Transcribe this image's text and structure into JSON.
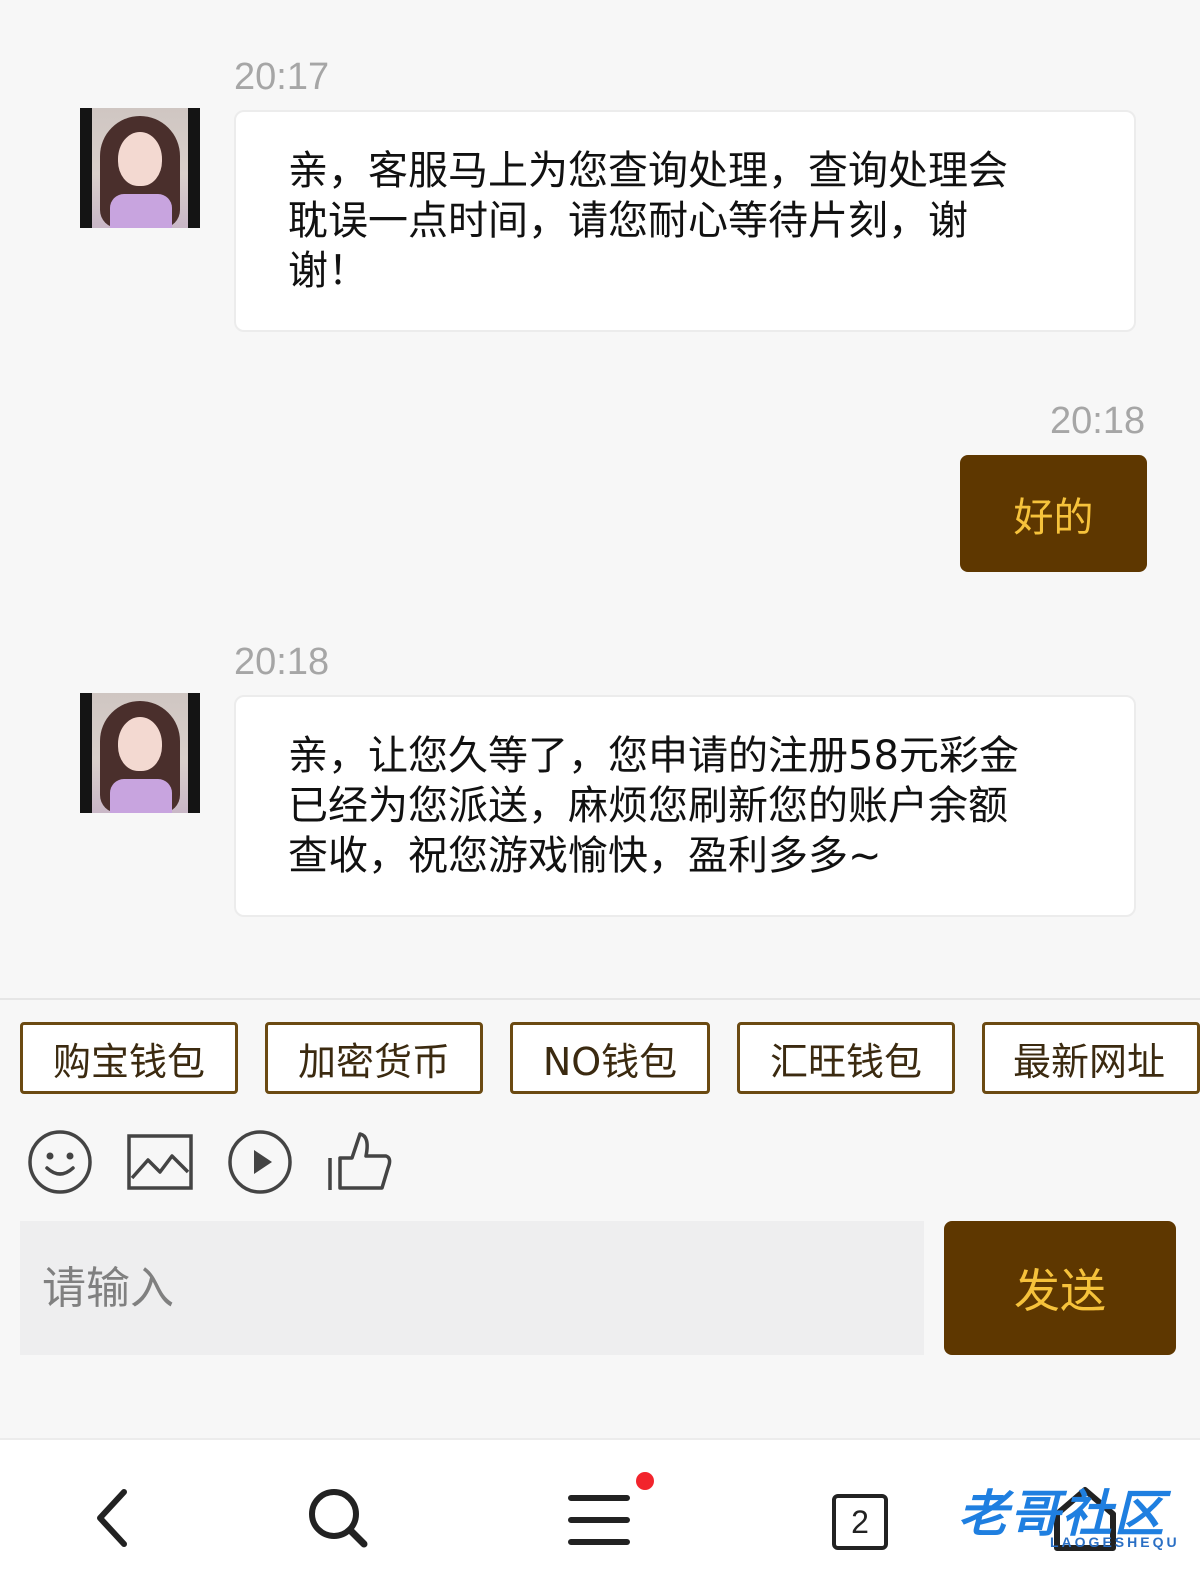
{
  "messages": [
    {
      "side": "incoming",
      "time": "20:17",
      "lines": [
        "亲，客服马上为您查询处理，查询处理会",
        "耽误一点时间，请您耐心等待片刻，谢",
        "谢！"
      ]
    },
    {
      "side": "outgoing",
      "time": "20:18",
      "text": "好的"
    },
    {
      "side": "incoming",
      "time": "20:18",
      "lines": [
        "亲，让您久等了，您申请的注册58元彩金",
        "已经为您派送，麻烦您刷新您的账户余额",
        "查收，祝您游戏愉快，盈利多多~"
      ]
    }
  ],
  "quick_replies": [
    "购宝钱包",
    "加密货币",
    "NO钱包",
    "汇旺钱包",
    "最新网址"
  ],
  "tools": [
    "emoji-icon",
    "image-icon",
    "video-icon",
    "thumbs-up-icon"
  ],
  "input": {
    "placeholder": "请输入",
    "value": ""
  },
  "send_label": "发送",
  "nav": {
    "icons": [
      "back-icon",
      "search-icon",
      "menu-icon",
      "tabs-icon",
      "home-icon"
    ],
    "tab_count": "2",
    "watermark": "老哥社区",
    "watermark_sub": "LAOGESHEQU"
  },
  "colors": {
    "accent": "#5e3700",
    "accent_text": "#f6c23b",
    "chip_border": "#6b4a12",
    "timestamp": "#a6a6a6",
    "badge": "#f2242c"
  }
}
